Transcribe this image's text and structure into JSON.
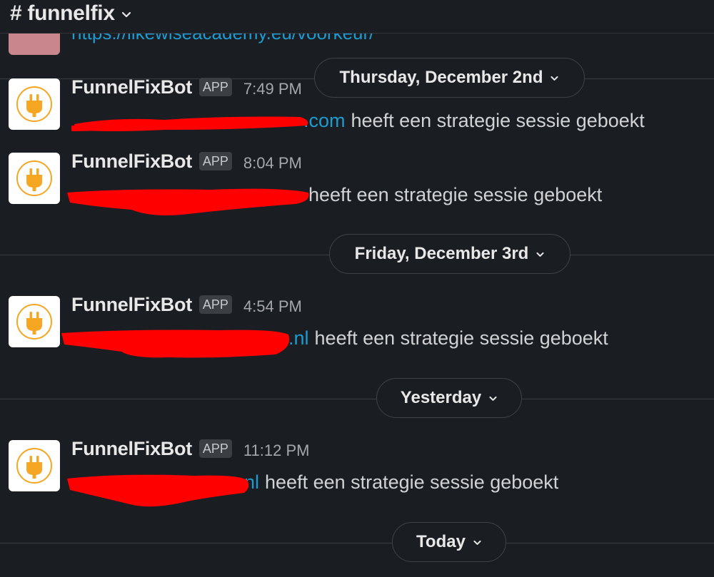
{
  "header": {
    "channel": "# funnelfix"
  },
  "previous": {
    "link_fragment": "https://likewiseacademy.eu/voorkeur/"
  },
  "dividers": [
    {
      "label": "Thursday, December 2nd"
    },
    {
      "label": "Friday, December 3rd"
    },
    {
      "label": "Yesterday"
    },
    {
      "label": "Today"
    }
  ],
  "messages": [
    {
      "sender": "FunnelFixBot",
      "badge": "APP",
      "time": "7:49 PM",
      "email_visible": ".com",
      "text": "heeft een strategie sessie geboekt"
    },
    {
      "sender": "FunnelFixBot",
      "badge": "APP",
      "time": "8:04 PM",
      "email_visible": "",
      "text": "heeft een strategie sessie geboekt"
    },
    {
      "sender": "FunnelFixBot",
      "badge": "APP",
      "time": "4:54 PM",
      "email_visible": ".nl",
      "text": "heeft een strategie sessie geboekt"
    },
    {
      "sender": "FunnelFixBot",
      "badge": "APP",
      "time": "11:12 PM",
      "email_visible": "nl",
      "text": "heeft een strategie sessie geboekt"
    }
  ],
  "colors": {
    "background": "#1a1d21",
    "link": "#1d9bd1",
    "redaction": "#ff0000",
    "avatar_icon": "#f5a623"
  }
}
